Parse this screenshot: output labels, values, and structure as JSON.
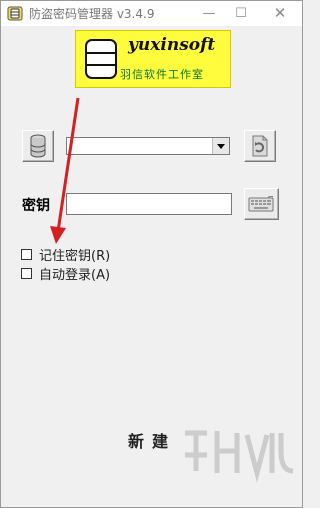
{
  "window": {
    "title": "防盗密码管理器 v3.4.9",
    "controls": {
      "minimize": "—",
      "maximize": "☐",
      "close": "✕"
    }
  },
  "logo": {
    "brand_en": "yuxinsoft",
    "brand_cn": "羽信软件工作室"
  },
  "database_selector": {
    "value": "",
    "options": []
  },
  "key": {
    "label": "密钥",
    "value": "",
    "placeholder": ""
  },
  "options": {
    "remember_key": {
      "label": "记住密钥(R)",
      "checked": false
    },
    "auto_login": {
      "label": "自动登录(A)",
      "checked": false
    }
  },
  "actions": {
    "new_label": "新建"
  },
  "colors": {
    "logo_bg": "#fffb3d",
    "logo_cn_text": "#0a7a2a",
    "annotation_arrow": "#d42020"
  },
  "icons": {
    "app": "database-icon",
    "db_button": "database-cylinder-icon",
    "refresh": "refresh-document-icon",
    "keyboard": "keyboard-icon",
    "dropdown": "chevron-down-icon",
    "watermark": "watermark-logo"
  }
}
